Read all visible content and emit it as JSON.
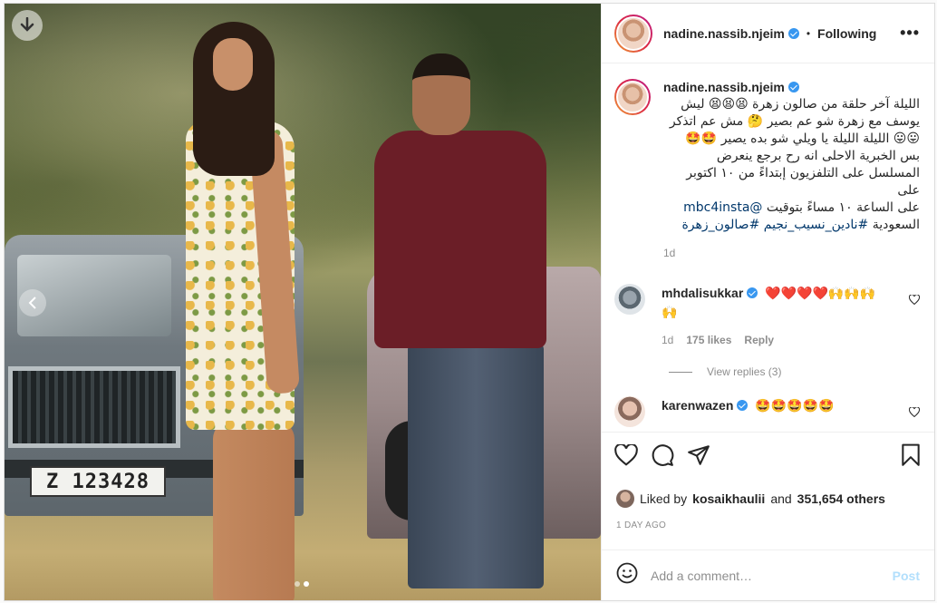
{
  "post": {
    "username": "nadine.nassib.njeim",
    "follow_label": "Following",
    "separator": "•",
    "more_label": "•••",
    "plate_text": "Z 123428",
    "caption": "الليلة آخر حلقة من صالون زهرة 😫😫😫 ليش يوسف مع زهرة شو عم بصير 🤔 مش عم اتذكر 😛😛 الليلة الليلة يا ويلي شو بده يصير 🤩🤩 بس الخبرية الاحلى انه رح برجع ينعرض المسلسل على التلفزيون إبتداءً من ١٠ اكتوبر على",
    "caption_line2": "على الساعة ١٠ مساءً بتوقيت ",
    "mention": "@mbc4insta",
    "caption_line3": "السعودية ",
    "hashtags": "#نادين_نسيب_نجيم #صالون_زهرة",
    "time": "1d"
  },
  "comments": [
    {
      "username": "mhdalisukkar",
      "text": "❤️❤️❤️❤️🙌🙌🙌🙌",
      "time": "1d",
      "likes": "175 likes",
      "reply": "Reply",
      "view_replies": "View replies (3)"
    },
    {
      "username": "karenwazen",
      "text": "🤩🤩🤩🤩🤩"
    }
  ],
  "likes": {
    "prefix": "Liked by",
    "user": "kosaikhaulii",
    "middle": "and",
    "count": "351,654 others"
  },
  "date": "1 DAY AGO",
  "add_comment": {
    "placeholder": "Add a comment…",
    "post_label": "Post"
  },
  "icons": {
    "download": "download-icon",
    "prev": "chevron-left-icon",
    "like": "heart-icon",
    "comment": "comment-icon",
    "share": "share-icon",
    "save": "bookmark-icon",
    "emoji": "emoji-icon"
  },
  "colors": {
    "verified": "#3897f0",
    "link": "#00376b",
    "muted": "#8e8e8e",
    "post_disabled": "#b2dffc"
  }
}
